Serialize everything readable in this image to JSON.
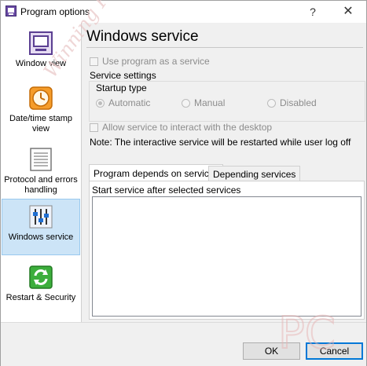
{
  "window": {
    "title": "Program options",
    "help_glyph": "?",
    "close_glyph": "✕"
  },
  "sidebar": {
    "items": [
      {
        "label": "Window view",
        "icon": "window-icon"
      },
      {
        "label": "Date/time stamp view",
        "icon": "clock-icon"
      },
      {
        "label": "Protocol and errors handling",
        "icon": "document-icon"
      },
      {
        "label": "Windows service",
        "icon": "sliders-icon"
      },
      {
        "label": "Restart & Security",
        "icon": "refresh-icon"
      }
    ],
    "active_index": 3
  },
  "page": {
    "title": "Windows service",
    "use_as_service_label": "Use program as a service",
    "service_settings_label": "Service settings",
    "startup_type_label": "Startup type",
    "startup_options": [
      "Automatic",
      "Manual",
      "Disabled"
    ],
    "startup_selected": "Automatic",
    "allow_interact_label": "Allow service to interact with the desktop",
    "note": "Note: The interactive service will be restarted while user log off",
    "tabs": [
      "Program depends on services",
      "Depending services"
    ],
    "active_tab": 0,
    "panel_label": "Start service after selected services"
  },
  "buttons": {
    "ok": "OK",
    "cancel": "Cancel"
  },
  "watermarks": {
    "diagonal_text": "Winning PC",
    "logo_text": "PC"
  },
  "colors": {
    "accent": "#0078d7",
    "active_bg": "#cce4f7",
    "disabled_text": "#8c8c8c"
  }
}
